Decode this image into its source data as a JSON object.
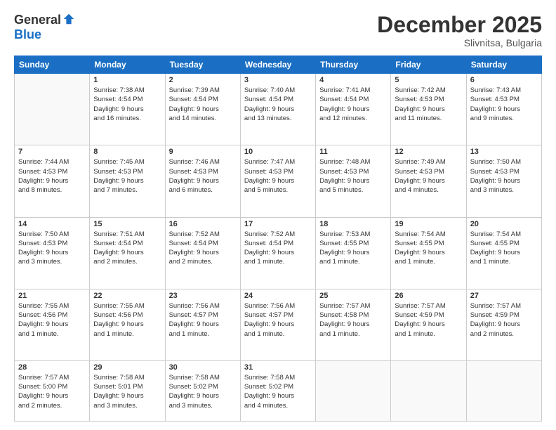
{
  "logo": {
    "general": "General",
    "blue": "Blue"
  },
  "title": "December 2025",
  "location": "Slivnitsa, Bulgaria",
  "days_of_week": [
    "Sunday",
    "Monday",
    "Tuesday",
    "Wednesday",
    "Thursday",
    "Friday",
    "Saturday"
  ],
  "weeks": [
    [
      {
        "num": "",
        "info": ""
      },
      {
        "num": "1",
        "info": "Sunrise: 7:38 AM\nSunset: 4:54 PM\nDaylight: 9 hours\nand 16 minutes."
      },
      {
        "num": "2",
        "info": "Sunrise: 7:39 AM\nSunset: 4:54 PM\nDaylight: 9 hours\nand 14 minutes."
      },
      {
        "num": "3",
        "info": "Sunrise: 7:40 AM\nSunset: 4:54 PM\nDaylight: 9 hours\nand 13 minutes."
      },
      {
        "num": "4",
        "info": "Sunrise: 7:41 AM\nSunset: 4:54 PM\nDaylight: 9 hours\nand 12 minutes."
      },
      {
        "num": "5",
        "info": "Sunrise: 7:42 AM\nSunset: 4:53 PM\nDaylight: 9 hours\nand 11 minutes."
      },
      {
        "num": "6",
        "info": "Sunrise: 7:43 AM\nSunset: 4:53 PM\nDaylight: 9 hours\nand 9 minutes."
      }
    ],
    [
      {
        "num": "7",
        "info": "Sunrise: 7:44 AM\nSunset: 4:53 PM\nDaylight: 9 hours\nand 8 minutes."
      },
      {
        "num": "8",
        "info": "Sunrise: 7:45 AM\nSunset: 4:53 PM\nDaylight: 9 hours\nand 7 minutes."
      },
      {
        "num": "9",
        "info": "Sunrise: 7:46 AM\nSunset: 4:53 PM\nDaylight: 9 hours\nand 6 minutes."
      },
      {
        "num": "10",
        "info": "Sunrise: 7:47 AM\nSunset: 4:53 PM\nDaylight: 9 hours\nand 5 minutes."
      },
      {
        "num": "11",
        "info": "Sunrise: 7:48 AM\nSunset: 4:53 PM\nDaylight: 9 hours\nand 5 minutes."
      },
      {
        "num": "12",
        "info": "Sunrise: 7:49 AM\nSunset: 4:53 PM\nDaylight: 9 hours\nand 4 minutes."
      },
      {
        "num": "13",
        "info": "Sunrise: 7:50 AM\nSunset: 4:53 PM\nDaylight: 9 hours\nand 3 minutes."
      }
    ],
    [
      {
        "num": "14",
        "info": "Sunrise: 7:50 AM\nSunset: 4:53 PM\nDaylight: 9 hours\nand 3 minutes."
      },
      {
        "num": "15",
        "info": "Sunrise: 7:51 AM\nSunset: 4:54 PM\nDaylight: 9 hours\nand 2 minutes."
      },
      {
        "num": "16",
        "info": "Sunrise: 7:52 AM\nSunset: 4:54 PM\nDaylight: 9 hours\nand 2 minutes."
      },
      {
        "num": "17",
        "info": "Sunrise: 7:52 AM\nSunset: 4:54 PM\nDaylight: 9 hours\nand 1 minute."
      },
      {
        "num": "18",
        "info": "Sunrise: 7:53 AM\nSunset: 4:55 PM\nDaylight: 9 hours\nand 1 minute."
      },
      {
        "num": "19",
        "info": "Sunrise: 7:54 AM\nSunset: 4:55 PM\nDaylight: 9 hours\nand 1 minute."
      },
      {
        "num": "20",
        "info": "Sunrise: 7:54 AM\nSunset: 4:55 PM\nDaylight: 9 hours\nand 1 minute."
      }
    ],
    [
      {
        "num": "21",
        "info": "Sunrise: 7:55 AM\nSunset: 4:56 PM\nDaylight: 9 hours\nand 1 minute."
      },
      {
        "num": "22",
        "info": "Sunrise: 7:55 AM\nSunset: 4:56 PM\nDaylight: 9 hours\nand 1 minute."
      },
      {
        "num": "23",
        "info": "Sunrise: 7:56 AM\nSunset: 4:57 PM\nDaylight: 9 hours\nand 1 minute."
      },
      {
        "num": "24",
        "info": "Sunrise: 7:56 AM\nSunset: 4:57 PM\nDaylight: 9 hours\nand 1 minute."
      },
      {
        "num": "25",
        "info": "Sunrise: 7:57 AM\nSunset: 4:58 PM\nDaylight: 9 hours\nand 1 minute."
      },
      {
        "num": "26",
        "info": "Sunrise: 7:57 AM\nSunset: 4:59 PM\nDaylight: 9 hours\nand 1 minute."
      },
      {
        "num": "27",
        "info": "Sunrise: 7:57 AM\nSunset: 4:59 PM\nDaylight: 9 hours\nand 2 minutes."
      }
    ],
    [
      {
        "num": "28",
        "info": "Sunrise: 7:57 AM\nSunset: 5:00 PM\nDaylight: 9 hours\nand 2 minutes."
      },
      {
        "num": "29",
        "info": "Sunrise: 7:58 AM\nSunset: 5:01 PM\nDaylight: 9 hours\nand 3 minutes."
      },
      {
        "num": "30",
        "info": "Sunrise: 7:58 AM\nSunset: 5:02 PM\nDaylight: 9 hours\nand 3 minutes."
      },
      {
        "num": "31",
        "info": "Sunrise: 7:58 AM\nSunset: 5:02 PM\nDaylight: 9 hours\nand 4 minutes."
      },
      {
        "num": "",
        "info": ""
      },
      {
        "num": "",
        "info": ""
      },
      {
        "num": "",
        "info": ""
      }
    ]
  ]
}
